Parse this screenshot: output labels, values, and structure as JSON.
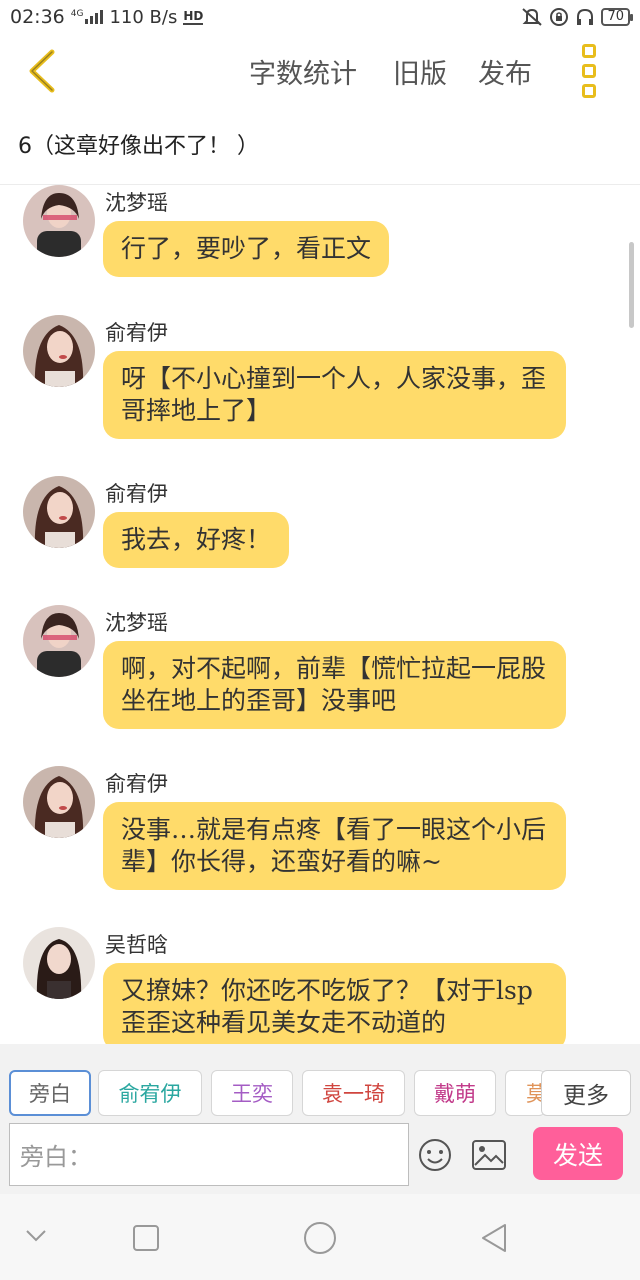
{
  "status_bar": {
    "time": "02:36",
    "network": "4G",
    "speed": "110 B/s",
    "hd": "HD",
    "battery": "70"
  },
  "header": {
    "word_count": "字数统计",
    "old_version": "旧版",
    "publish": "发布"
  },
  "chapter_title": "6（这章好像出不了！ ）",
  "messages": [
    {
      "name": "沈梦瑶",
      "text": "行了，要吵了，看正文"
    },
    {
      "name": "俞宥伊",
      "text": "呀【不小心撞到一个人，人家没事，歪哥摔地上了】"
    },
    {
      "name": "俞宥伊",
      "text": "我去，好疼！"
    },
    {
      "name": "沈梦瑶",
      "text": "啊，对不起啊，前辈【慌忙拉起一屁股坐在地上的歪哥】没事吧"
    },
    {
      "name": "俞宥伊",
      "text": "没事…就是有点疼【看了一眼这个小后辈】你长得，还蛮好看的嘛~"
    },
    {
      "name": "吴哲晗",
      "text": "又撩妹？你还吃不吃饭了？【对于lsp歪歪这种看见美女走不动道的"
    }
  ],
  "roles": [
    {
      "label": "旁白",
      "color": "#666666"
    },
    {
      "label": "俞宥伊",
      "color": "#2aa7a0"
    },
    {
      "label": "王奕",
      "color": "#a45cc4"
    },
    {
      "label": "袁一琦",
      "color": "#d0453f"
    },
    {
      "label": "戴萌",
      "color": "#c23a8a"
    },
    {
      "label": "莫",
      "color": "#e0945a"
    }
  ],
  "more_label": "更多",
  "input": {
    "placeholder": "旁白："
  },
  "send_label": "发送",
  "colors": {
    "bubble": "#ffdb6a",
    "send": "#ff5f9a",
    "accent": "#e8bd1c"
  }
}
